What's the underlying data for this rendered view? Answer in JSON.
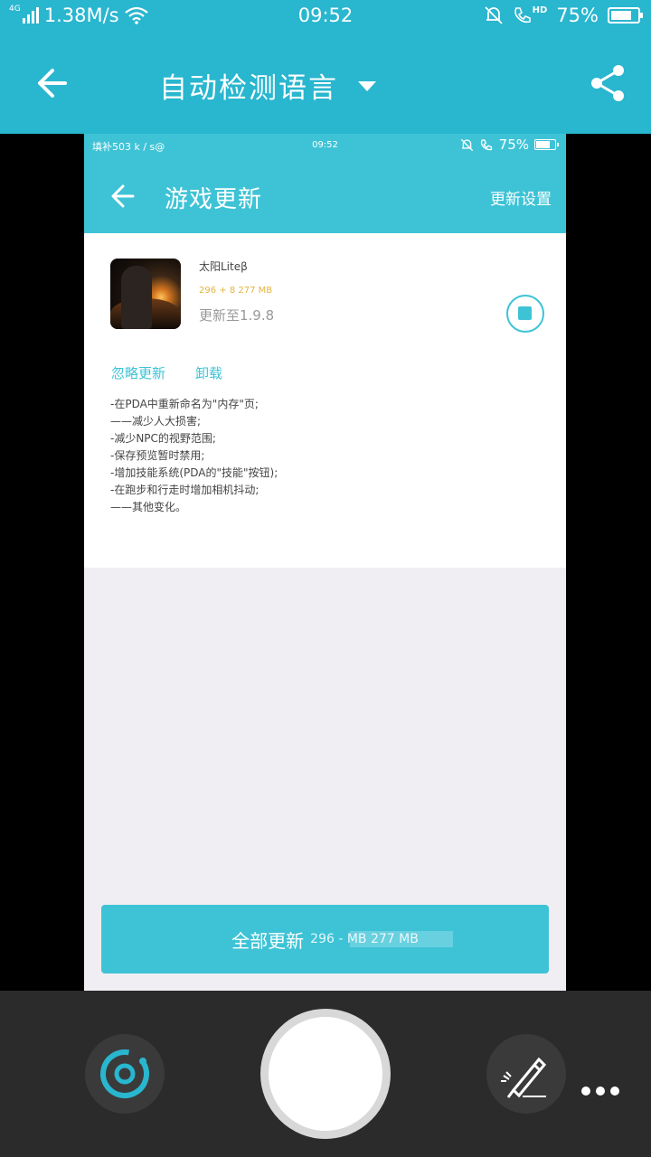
{
  "status_bar": {
    "network": "4G",
    "speed": "1.38M/s",
    "time": "09:52",
    "hd": "HD",
    "battery": "75%"
  },
  "app_bar": {
    "language": "自动检测语言"
  },
  "preview": {
    "status_bar": {
      "left": "填补503 k / s@",
      "time": "09:52",
      "battery": "75%"
    },
    "header": {
      "title": "游戏更新",
      "settings": "更新设置"
    },
    "app": {
      "name": "太阳Liteβ",
      "size": "296 + 8 277 MB",
      "version": "更新至1.9.8"
    },
    "actions": {
      "ignore": "忽略更新",
      "uninstall": "卸载"
    },
    "notes": [
      "-在PDA中重新命名为\"内存\"页;",
      "——减少人大损害;",
      "-减少NPC的视野范围;",
      "-保存预览暂时禁用;",
      "-增加技能系统(PDA的\"技能\"按钮);",
      "-在跑步和行走时增加相机抖动;",
      "——其他变化。"
    ],
    "update_all": {
      "label": "全部更新",
      "size": "296 - MB 277 MB"
    }
  },
  "colors": {
    "accent": "#29b6cf",
    "preview_accent": "#3ec3d6",
    "size_text": "#e4b540",
    "bottom_bar": "#2b2b2c"
  },
  "icons": [
    "back-arrow-icon",
    "dropdown-caret-icon",
    "share-icon",
    "stop-icon",
    "lens-icon",
    "magic-edit-icon",
    "more-icon"
  ]
}
